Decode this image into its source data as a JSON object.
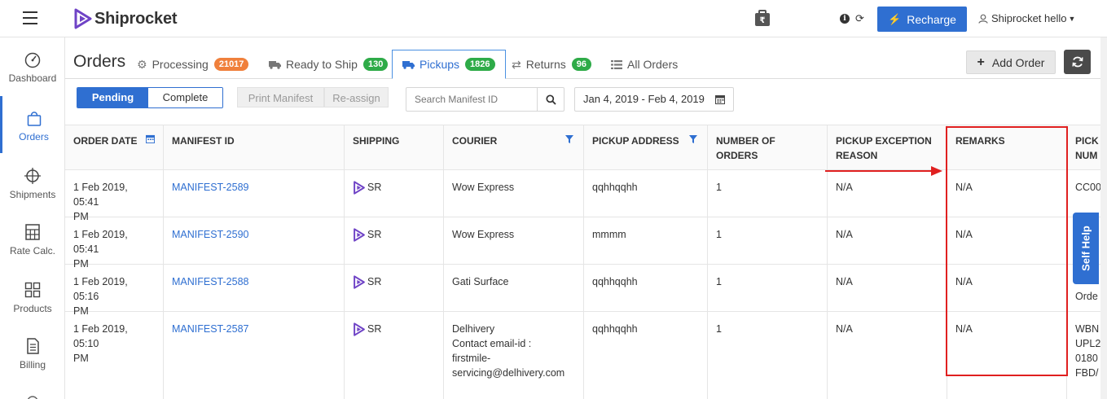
{
  "header": {
    "brand": "Shiprocket",
    "recharge_label": "Recharge",
    "user_label": "Shiprocket hello"
  },
  "sidebar": {
    "items": [
      {
        "label": "Dashboard",
        "icon": "dashboard-gauge-icon"
      },
      {
        "label": "Orders",
        "icon": "orders-bag-icon",
        "active": true
      },
      {
        "label": "Shipments",
        "icon": "shipments-crosshair-icon"
      },
      {
        "label": "Rate Calc.",
        "icon": "calculator-icon"
      },
      {
        "label": "Products",
        "icon": "products-grid-icon"
      },
      {
        "label": "Billing",
        "icon": "billing-document-icon"
      }
    ]
  },
  "page": {
    "title": "Orders",
    "tabs": [
      {
        "label": "Processing",
        "count": "21017",
        "icon": "gears-icon",
        "color": "#f0803c"
      },
      {
        "label": "Ready to Ship",
        "count": "130",
        "icon": "truck-icon",
        "color": "#2eab48"
      },
      {
        "label": "Pickups",
        "count": "1826",
        "icon": "truck-icon",
        "color": "#2eab48",
        "active": true
      },
      {
        "label": "Returns",
        "count": "96",
        "icon": "exchange-icon",
        "color": "#2eab48"
      },
      {
        "label": "All Orders",
        "count": "",
        "icon": "list-icon",
        "color": ""
      }
    ],
    "add_order_label": "Add Order"
  },
  "filters": {
    "pending_label": "Pending",
    "complete_label": "Complete",
    "print_manifest_label": "Print Manifest",
    "reassign_label": "Re-assign",
    "search_placeholder": "Search Manifest ID",
    "date_range": "Jan 4, 2019 - Feb 4, 2019"
  },
  "table": {
    "columns": {
      "order_date": "ORDER DATE",
      "manifest_id": "MANIFEST ID",
      "shipping": "SHIPPING",
      "courier": "COURIER",
      "pickup_address": "PICKUP ADDRESS",
      "number_of_orders": "NUMBER OF ORDERS",
      "pickup_exception_line1": "PICKUP EXCEPTION",
      "pickup_exception_line2": "REASON",
      "remarks": "REMARKS",
      "pick_num_line1": "PICK",
      "pick_num_line2": "NUM"
    },
    "rows": [
      {
        "date1": "1 Feb 2019, 05:41",
        "date2": "PM",
        "manifest": "MANIFEST-2589",
        "shipping": "SR",
        "courier": [
          "Wow Express"
        ],
        "address": "qqhhqqhh",
        "orders": "1",
        "exception": "N/A",
        "remarks": "N/A",
        "pick": [
          "CC00"
        ]
      },
      {
        "date1": "1 Feb 2019, 05:41",
        "date2": "PM",
        "manifest": "MANIFEST-2590",
        "shipping": "SR",
        "courier": [
          "Wow Express"
        ],
        "address": "mmmm",
        "orders": "1",
        "exception": "N/A",
        "remarks": "N/A",
        "pick": [
          ""
        ]
      },
      {
        "date1": "1 Feb 2019, 05:16",
        "date2": "PM",
        "manifest": "MANIFEST-2588",
        "shipping": "SR",
        "courier": [
          "Gati Surface"
        ],
        "address": "qqhhqqhh",
        "orders": "1",
        "exception": "N/A",
        "remarks": "N/A",
        "pick": [
          "Orde"
        ]
      },
      {
        "date1": "1 Feb 2019, 05:10",
        "date2": "PM",
        "manifest": "MANIFEST-2587",
        "shipping": "SR",
        "courier": [
          "Delhivery",
          "Contact email-id :",
          "firstmile-",
          "servicing@delhivery.com"
        ],
        "address": "qqhhqqhh",
        "orders": "1",
        "exception": "N/A",
        "remarks": "N/A",
        "pick": [
          "WBN",
          "UPL2",
          "0180",
          "FBD/"
        ]
      }
    ]
  },
  "self_help_label": "Self Help"
}
